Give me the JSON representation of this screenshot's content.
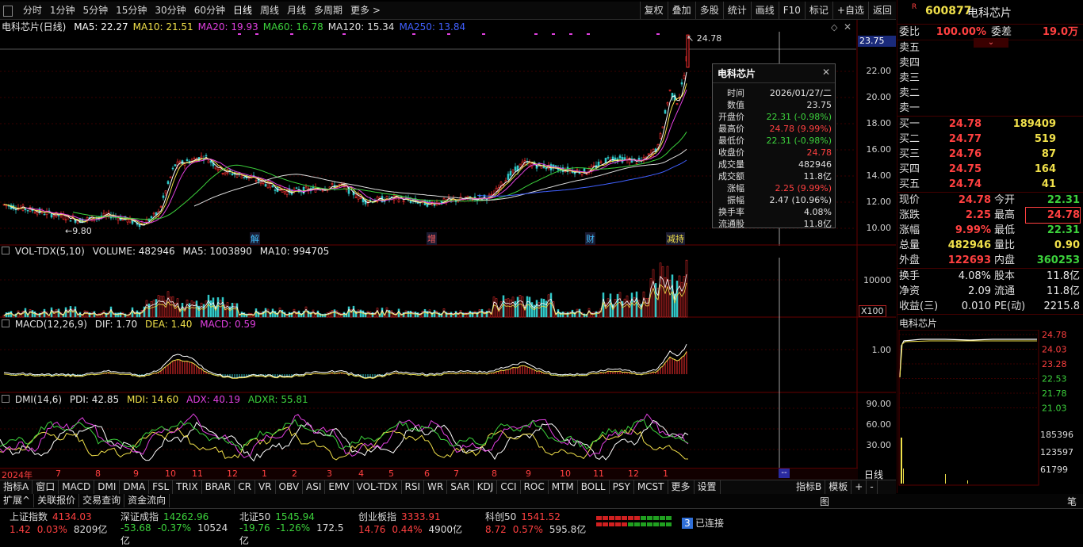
{
  "toolbar": {
    "periods": [
      "分时",
      "1分钟",
      "5分钟",
      "15分钟",
      "30分钟",
      "60分钟",
      "日线",
      "周线",
      "月线",
      "多周期",
      "更多 >"
    ],
    "active_period": "日线",
    "right": [
      "复权",
      "叠加",
      "多股",
      "统计",
      "画线",
      "F10",
      "标记",
      "+自选",
      "返回"
    ]
  },
  "main_chart": {
    "title": "电科芯片(日线)",
    "ma": [
      {
        "label": "MA5: 22.27",
        "color": "#ffffff"
      },
      {
        "label": "MA10: 21.51",
        "color": "#f0e04a"
      },
      {
        "label": "MA20: 19.93",
        "color": "#e040e0"
      },
      {
        "label": "MA60: 16.78",
        "color": "#3cd23c"
      },
      {
        "label": "MA120: 15.34",
        "color": "#e0e0e0"
      },
      {
        "label": "MA250: 13.84",
        "color": "#4060ff"
      }
    ],
    "y_ticks": [
      "22.00",
      "20.00",
      "18.00",
      "16.00",
      "14.00",
      "12.00",
      "10.00"
    ],
    "current_box": "23.75",
    "high_label": "24.78",
    "low_label": "9.80",
    "events": [
      "解",
      "增",
      "财",
      "减持"
    ]
  },
  "tooltip": {
    "title": "电科芯片",
    "rows": [
      {
        "k": "时间",
        "v": "2026/01/27/二",
        "c": "#e0e0e0"
      },
      {
        "k": "数值",
        "v": "23.75",
        "c": "#e0e0e0"
      },
      {
        "k": "开盘价",
        "v": "22.31 (-0.98%)",
        "c": "#3cd23c"
      },
      {
        "k": "最高价",
        "v": "24.78 (9.99%)",
        "c": "#ff4040"
      },
      {
        "k": "最低价",
        "v": "22.31 (-0.98%)",
        "c": "#3cd23c"
      },
      {
        "k": "收盘价",
        "v": "24.78",
        "c": "#ff4040"
      },
      {
        "k": "成交量",
        "v": "482946",
        "c": "#e0e0e0"
      },
      {
        "k": "成交额",
        "v": "11.8亿",
        "c": "#e0e0e0"
      },
      {
        "k": "涨幅",
        "v": "2.25 (9.99%)",
        "c": "#ff4040"
      },
      {
        "k": "振幅",
        "v": "2.47 (10.96%)",
        "c": "#e0e0e0"
      },
      {
        "k": "换手率",
        "v": "4.08%",
        "c": "#e0e0e0"
      },
      {
        "k": "流通股",
        "v": "11.8亿",
        "c": "#e0e0e0"
      }
    ]
  },
  "volume": {
    "label": "VOL-TDX(5,10)",
    "vol": "VOLUME: 482946",
    "ma5": "MA5: 1003890",
    "ma10": "MA10: 994705",
    "tick": "10000",
    "unit": "X100"
  },
  "macd": {
    "label": "MACD(12,26,9)",
    "dif": "DIF: 1.70",
    "dea": "DEA: 1.40",
    "macd": "MACD: 0.59",
    "tick": "1.00"
  },
  "dmi": {
    "label": "DMI(14,6)",
    "pdi": "PDI: 42.85",
    "mdi": "MDI: 14.60",
    "adx": "ADX: 40.19",
    "adxr": "ADXR: 55.81",
    "ticks": [
      "90.00",
      "60.00",
      "30.00"
    ]
  },
  "time_axis": {
    "year": "2024年",
    "months": [
      "7",
      "8",
      "9",
      "10",
      "11",
      "12",
      "1",
      "2",
      "3",
      "4",
      "5",
      "6",
      "7",
      "8",
      "9",
      "10",
      "11",
      "12",
      "1"
    ],
    "right_label": "日线",
    "marker": "--"
  },
  "indicator_tabs": [
    "指标A",
    "窗口",
    "MACD",
    "DMI",
    "DMA",
    "FSL",
    "TRIX",
    "BRAR",
    "CR",
    "VR",
    "OBV",
    "ASI",
    "EMV",
    "VOL-TDX",
    "RSI",
    "WR",
    "SAR",
    "KDJ",
    "CCI",
    "ROC",
    "MTM",
    "BOLL",
    "PSY",
    "MCST",
    "更多",
    "设置"
  ],
  "indicator_right": [
    "指标B",
    "模板",
    "+",
    "-"
  ],
  "bottom_tabs": [
    "扩展^",
    "关联报价",
    "交易查询",
    "资金流向"
  ],
  "right_panel": {
    "r_badge": "R",
    "code": "600877",
    "name": "电科芯片",
    "weibi_label": "委比",
    "weibi": "100.00%",
    "weicha_label": "委差",
    "weicha": "19.0万",
    "sells": [
      "卖五",
      "卖四",
      "卖三",
      "卖二",
      "卖一"
    ],
    "buys": [
      {
        "label": "买一",
        "price": "24.78",
        "vol": "189409"
      },
      {
        "label": "买二",
        "price": "24.77",
        "vol": "519"
      },
      {
        "label": "买三",
        "price": "24.76",
        "vol": "87"
      },
      {
        "label": "买四",
        "price": "24.75",
        "vol": "164"
      },
      {
        "label": "买五",
        "price": "24.74",
        "vol": "41"
      }
    ],
    "stats": [
      {
        "l1": "现价",
        "v1": "24.78",
        "c1": "#ff4040",
        "l2": "今开",
        "v2": "22.31",
        "c2": "#3cd23c"
      },
      {
        "l1": "涨跌",
        "v1": "2.25",
        "c1": "#ff4040",
        "l2": "最高",
        "v2": "24.78",
        "c2": "#ff4040"
      },
      {
        "l1": "涨幅",
        "v1": "9.99%",
        "c1": "#ff4040",
        "l2": "最低",
        "v2": "22.31",
        "c2": "#3cd23c"
      },
      {
        "l1": "总量",
        "v1": "482946",
        "c1": "#f0e04a",
        "l2": "量比",
        "v2": "0.90",
        "c2": "#f0e04a"
      },
      {
        "l1": "外盘",
        "v1": "122693",
        "c1": "#ff4040",
        "l2": "内盘",
        "v2": "360253",
        "c2": "#3cd23c"
      }
    ],
    "stats2": [
      {
        "l1": "换手",
        "v1": "4.08%",
        "l2": "股本",
        "v2": "11.8亿"
      },
      {
        "l1": "净资",
        "v1": "2.09",
        "l2": "流通",
        "v2": "11.8亿"
      },
      {
        "l1": "收益(三)",
        "v1": "0.010",
        "l2": "PE(动)",
        "v2": "2215.8"
      }
    ],
    "mini_title": "电科芯片",
    "mini_price_ticks": [
      "24.78",
      "24.03",
      "23.28",
      "22.53",
      "21.78",
      "21.03"
    ],
    "mini_vol_ticks": [
      "185396",
      "123597",
      "61799"
    ]
  },
  "status_bar": {
    "indices": [
      {
        "name": "上证指数",
        "value": "4134.03",
        "chg": "1.42",
        "pct": "0.03%",
        "amt": "8209亿",
        "color": "#ff4040"
      },
      {
        "name": "深证成指",
        "value": "14262.96",
        "chg": "-53.68",
        "pct": "-0.37%",
        "amt": "10524亿",
        "color": "#3cd23c"
      },
      {
        "name": "北证50",
        "value": "1545.94",
        "chg": "-19.76",
        "pct": "-1.26%",
        "amt": "172.5亿",
        "color": "#3cd23c"
      },
      {
        "name": "创业板指",
        "value": "3333.91",
        "chg": "14.76",
        "pct": "0.44%",
        "amt": "4900亿",
        "color": "#ff4040"
      },
      {
        "name": "科创50",
        "value": "1541.52",
        "chg": "8.72",
        "pct": "0.57%",
        "amt": "595.8亿",
        "color": "#ff4040"
      }
    ],
    "conn_count": "3",
    "conn_label": "已连接"
  }
}
